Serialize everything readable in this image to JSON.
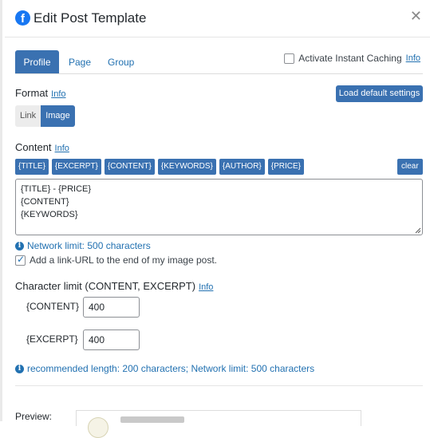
{
  "header": {
    "title": "Edit Post Template",
    "icon": "facebook-icon"
  },
  "tabs": [
    {
      "label": "Profile",
      "active": true
    },
    {
      "label": "Page",
      "active": false
    },
    {
      "label": "Group",
      "active": false
    }
  ],
  "caching": {
    "label": "Activate Instant Caching",
    "info": "Info",
    "checked": false
  },
  "format": {
    "label": "Format",
    "info": "Info",
    "load_defaults": "Load default settings",
    "options": [
      {
        "label": "Link",
        "selected": false
      },
      {
        "label": "Image",
        "selected": true
      }
    ]
  },
  "content": {
    "label": "Content",
    "info": "Info",
    "tags": [
      "{TITLE}",
      "{EXCERPT}",
      "{CONTENT}",
      "{KEYWORDS}",
      "{AUTHOR}",
      "{PRICE}"
    ],
    "clear": "clear",
    "lines": [
      "{TITLE} - {PRICE}",
      "{CONTENT}",
      "{KEYWORDS}"
    ],
    "network_limit": "Network limit: 500 characters",
    "link_url": {
      "label": "Add a link-URL to the end of my image post.",
      "checked": true
    }
  },
  "char_limit": {
    "label": "Character limit (CONTENT, EXCERPT)",
    "info": "Info",
    "rows": [
      {
        "label": "{CONTENT}",
        "value": "400"
      },
      {
        "label": "{EXCERPT}",
        "value": "400"
      }
    ],
    "note": "recommended length: 200 characters; Network limit: 500 characters"
  },
  "preview": {
    "label": "Preview:"
  },
  "colors": {
    "accent": "#3a71b1",
    "link": "#2271b1",
    "facebook": "#1877f2"
  }
}
